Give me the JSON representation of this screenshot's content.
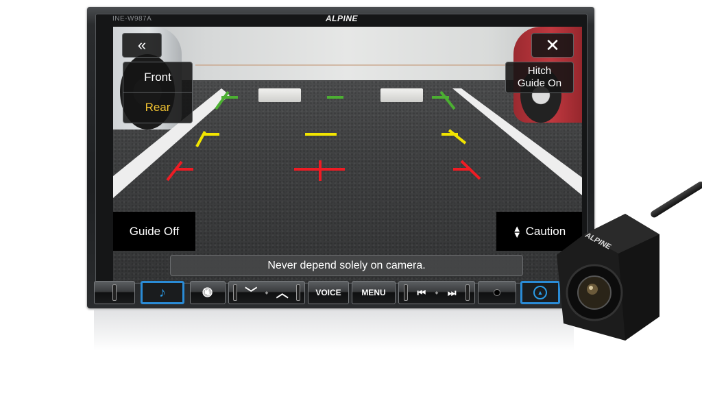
{
  "device": {
    "model": "INE-W987A",
    "brand": "ALPINE"
  },
  "screen": {
    "back_button": {
      "icon": "double-chevron-left-icon",
      "glyph": "«"
    },
    "close_button": {
      "icon": "close-icon",
      "glyph": "✕"
    },
    "camera_select": {
      "options": [
        {
          "label": "Front",
          "selected": false
        },
        {
          "label": "Rear",
          "selected": true
        }
      ]
    },
    "hitch_button": {
      "line1": "Hitch",
      "line2": "Guide On"
    },
    "guide_button": {
      "label": "Guide Off"
    },
    "caution_button": {
      "label": "Caution",
      "icon": "up-down-arrows-icon"
    },
    "warning_text": "Never depend solely on camera.",
    "guide_lines": {
      "colors": {
        "near": "#ee1c24",
        "mid": "#f2e500",
        "far": "#4caf32"
      }
    }
  },
  "controls": {
    "music_button": {
      "icon": "music-note-icon",
      "glyph": "♪"
    },
    "mute_button": {
      "icon": "mute-icon",
      "glyph": "🔇"
    },
    "volume_down": {
      "icon": "chevron-down-icon",
      "glyph": "﹀"
    },
    "volume_up": {
      "icon": "chevron-up-icon",
      "glyph": "︿"
    },
    "voice_button": {
      "label": "VOICE"
    },
    "menu_button": {
      "label": "MENU"
    },
    "prev_button": {
      "icon": "skip-previous-icon",
      "glyph": "⏮"
    },
    "next_button": {
      "icon": "skip-next-icon",
      "glyph": "⏭"
    },
    "aux_jack": {
      "icon": "aux-jack-icon"
    },
    "nav_button": {
      "icon": "navigation-arrow-icon",
      "glyph": "▲"
    },
    "accent_color": "#2a8bd6"
  },
  "accessory": {
    "camera_brand": "ALPINE"
  }
}
